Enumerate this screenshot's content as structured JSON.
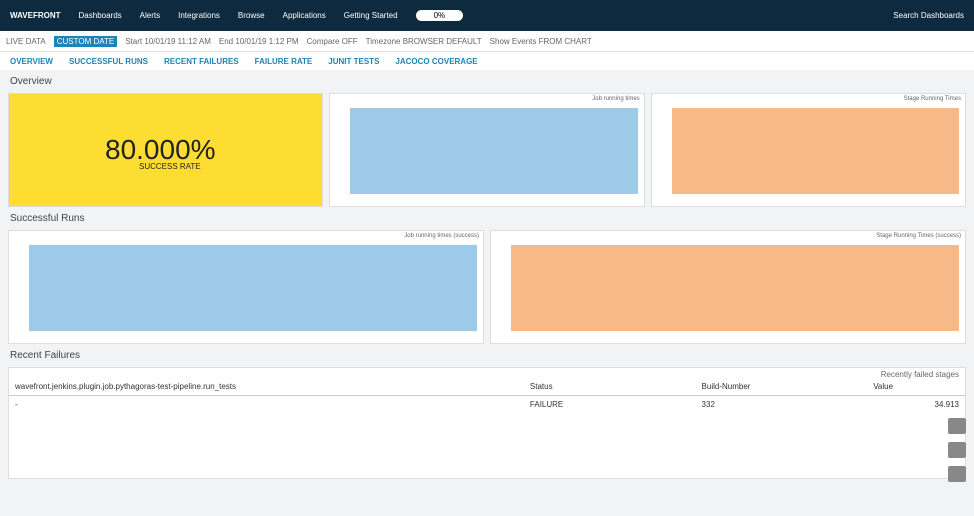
{
  "top": {
    "logo": "WAVEFRONT",
    "dash": "Dashboards",
    "alerts": "Alerts",
    "integrations": "Integrations",
    "browse": "Browse",
    "apps": "Applications",
    "gs": "Getting Started",
    "pct": "0%",
    "search": "Search Dashboards"
  },
  "toolbar": {
    "live": "LIVE DATA",
    "custom": "CUSTOM DATE",
    "start": "Start 10/01/19 11:12 AM",
    "end": "End 10/01/19 1:12 PM",
    "compare": "Compare OFF",
    "tz": "Timezone BROWSER DEFAULT",
    "se": "Show Events FROM CHART"
  },
  "tabs": [
    "OVERVIEW",
    "SUCCESSFUL RUNS",
    "RECENT FAILURES",
    "FAILURE RATE",
    "JUNIT TESTS",
    "JACOCO COVERAGE"
  ],
  "sections": {
    "overview": "Overview",
    "success": "Successful Runs",
    "fails": "Recent Failures"
  },
  "cards": {
    "sr": "80.000%",
    "srl": "SUCCESS RATE",
    "jrt": "Job running times",
    "srt": "Stage Running Times",
    "jrts": "Job running times (success)",
    "srts": "Stage Running Times (success)"
  },
  "table": {
    "title": "Recently failed stages",
    "h1": "wavefront.jenkins.plugin.job.pythagoras-test-pipeline.run_tests",
    "h2": "Status",
    "h3": "Build-Number",
    "h4": "Value",
    "c1": "-",
    "c2": "FAILURE",
    "c3": "332",
    "c4": "34.913"
  }
}
